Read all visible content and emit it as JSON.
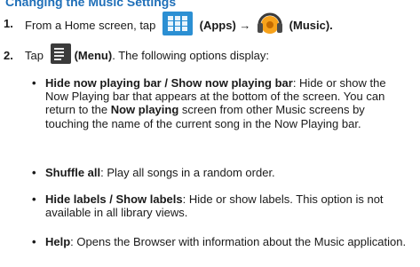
{
  "heading": "Changing the Music Settings",
  "steps": [
    {
      "number": "1.",
      "text_a": "From a Home screen, tap",
      "text_b": "(Apps) →",
      "text_c": "(Music)."
    },
    {
      "number": "2.",
      "text_a": "Tap",
      "text_b": "(Menu)",
      "text_c": ". The following options display:"
    }
  ],
  "bullet_symbol": "•",
  "options": [
    {
      "term": "Hide now playing bar / Show now playing bar",
      "desc": ": Hide or show the Now Playing bar that appears at the bottom of the screen. You can return to the ",
      "term2": "Now playing",
      "desc2": " screen from other Music screens by touching the name of the current song in the Now Playing bar."
    },
    {
      "term": "Shuffle all",
      "desc": ": Play all songs in a random order."
    },
    {
      "term": "Hide labels / Show labels",
      "desc": ": Hide or show labels. This option is not available in all library views."
    },
    {
      "term": "Help",
      "desc": ": Opens the Browser with information about the Music application."
    }
  ],
  "colors": {
    "heading": "#1f6fb8",
    "apps_icon": "#2b8fd3",
    "menu_icon": "#3b3b3b"
  },
  "icons": [
    "apps-icon",
    "music-icon",
    "menu-icon"
  ]
}
